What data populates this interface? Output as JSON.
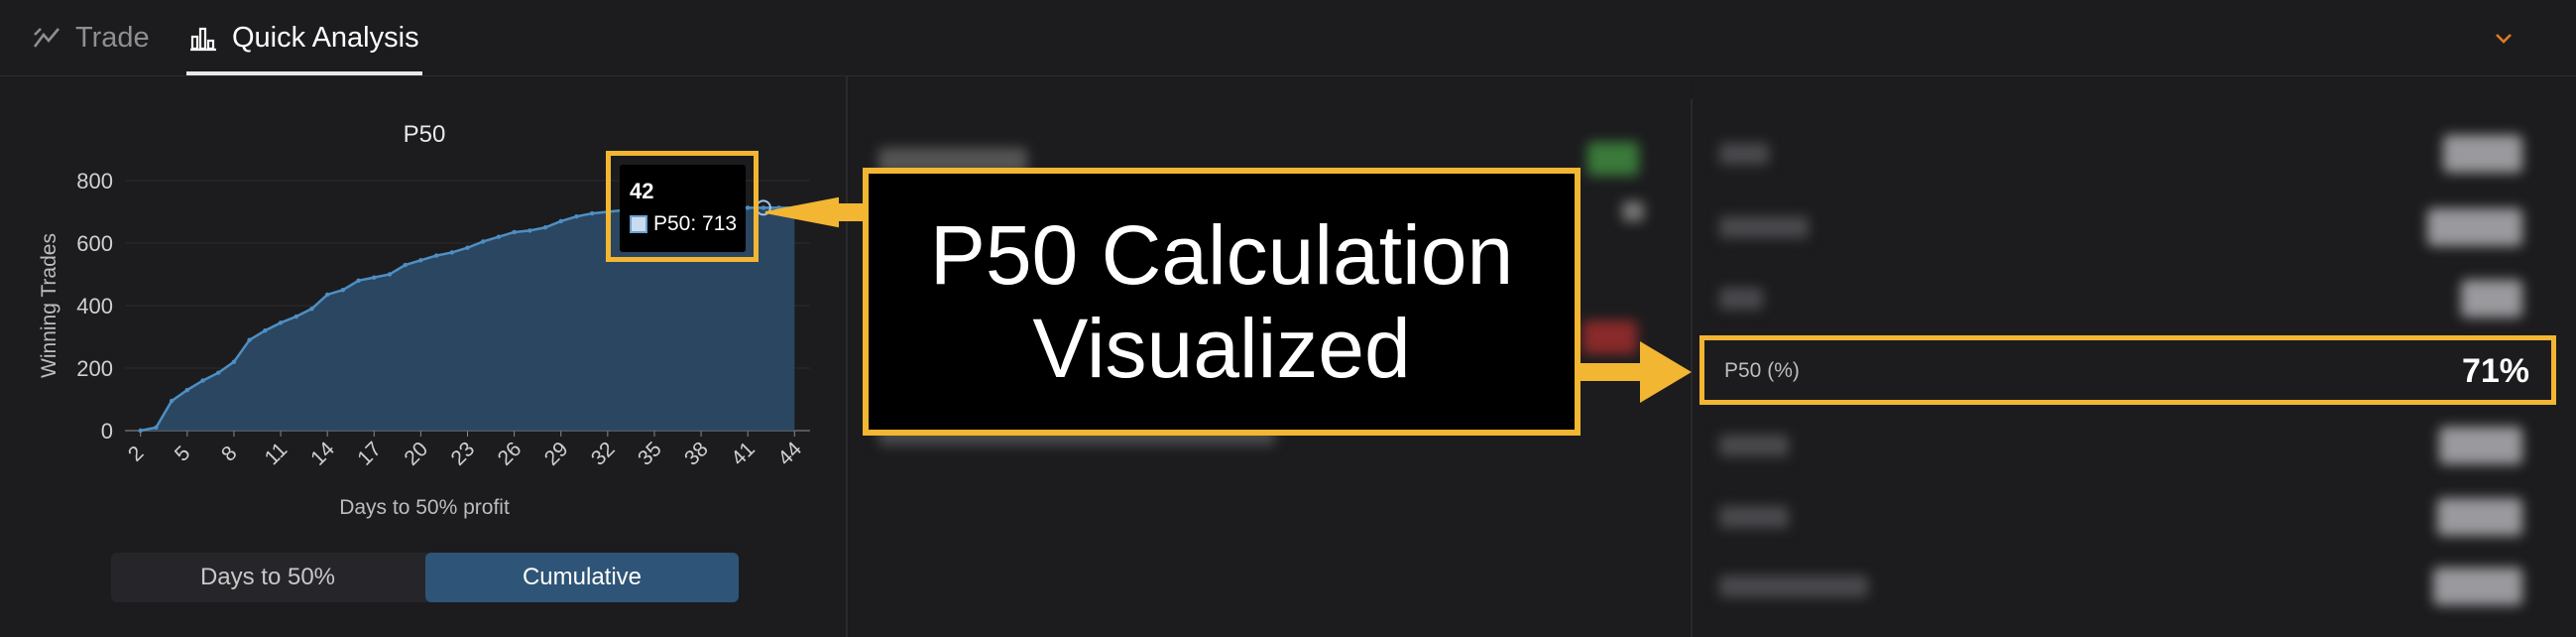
{
  "tabs": [
    {
      "label": "Trade",
      "icon": "trend-line-icon",
      "active": false
    },
    {
      "label": "Quick Analysis",
      "icon": "bar-chart-icon",
      "active": true
    }
  ],
  "chart_data": {
    "type": "area",
    "title": "P50",
    "xlabel": "Days to 50% profit",
    "ylabel": "Winning Trades",
    "ylim": [
      0,
      800
    ],
    "yticks": [
      0,
      200,
      400,
      600,
      800
    ],
    "xticks": [
      2,
      5,
      8,
      11,
      14,
      17,
      20,
      23,
      26,
      29,
      32,
      35,
      38,
      41,
      44
    ],
    "x": [
      2,
      3,
      4,
      5,
      6,
      7,
      8,
      9,
      10,
      11,
      12,
      13,
      14,
      15,
      16,
      17,
      18,
      19,
      20,
      21,
      22,
      23,
      24,
      25,
      26,
      27,
      28,
      29,
      30,
      31,
      32,
      33,
      34,
      35,
      36,
      37,
      38,
      39,
      40,
      41,
      42,
      43,
      44
    ],
    "y": [
      0,
      10,
      95,
      130,
      160,
      185,
      220,
      290,
      320,
      345,
      365,
      390,
      435,
      450,
      480,
      490,
      500,
      530,
      545,
      560,
      570,
      585,
      605,
      620,
      635,
      640,
      650,
      670,
      685,
      695,
      700,
      705,
      708,
      710,
      711,
      712,
      712,
      713,
      713,
      713,
      713,
      713,
      713
    ],
    "series_color": "#2e4e6c",
    "line_color": "#4e8fc4",
    "tooltip": {
      "x_label": "42",
      "series_text": "P50: 713"
    }
  },
  "toggle": {
    "days_label": "Days to 50%",
    "cumulative_label": "Cumulative",
    "active": "Cumulative"
  },
  "p50_metric": {
    "label": "P50 (%)",
    "value": "71%"
  },
  "annotation": {
    "line1": "P50 Calculation",
    "line2": "Visualized",
    "border_color": "#f2b632"
  }
}
